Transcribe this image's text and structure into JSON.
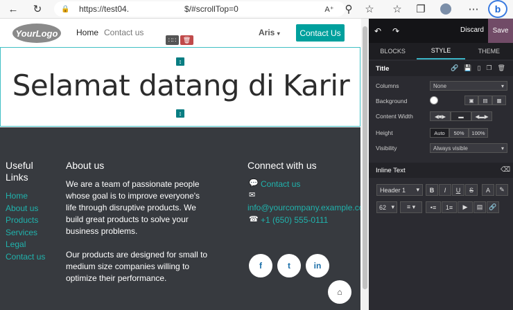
{
  "browser": {
    "url": "https://test04.",
    "url_tail": "$/#scrollTop=0",
    "back_icon": "arrow-left",
    "reload_icon": "refresh",
    "bing_icon": "bing"
  },
  "site": {
    "logo_text": "YourLogo",
    "nav": [
      "Home",
      "Contact us"
    ],
    "user": "Aris",
    "cta": "Contact Us",
    "hero_title": "Selamat datang di Karir",
    "footer": {
      "useful_links_title": "Useful Links",
      "links": [
        "Home",
        "About us",
        "Products",
        "Services",
        "Legal",
        "Contact us"
      ],
      "about_title": "About us",
      "about_p1": "We are a team of passionate people whose goal is to improve everyone's life through disruptive products. We build great products to solve your business problems.",
      "about_p2": "Our products are designed for small to medium size companies willing to optimize their performance.",
      "connect_title": "Connect with us",
      "contact_link": "Contact us",
      "email": "info@yourcompany.example.com",
      "phone": "+1 (650) 555-0111"
    }
  },
  "editor": {
    "discard": "Discard",
    "save": "Save",
    "tabs": [
      "BLOCKS",
      "STYLE",
      "THEME"
    ],
    "section_title": "Title",
    "columns_label": "Columns",
    "columns_value": "None",
    "background_label": "Background",
    "content_width_label": "Content Width",
    "height_label": "Height",
    "height_options": [
      "Auto",
      "50%",
      "100%"
    ],
    "visibility_label": "Visibility",
    "visibility_value": "Always visible",
    "inline_text_title": "Inline Text",
    "header_style": "Header 1",
    "font_size": "62",
    "accent": "#714b67"
  }
}
